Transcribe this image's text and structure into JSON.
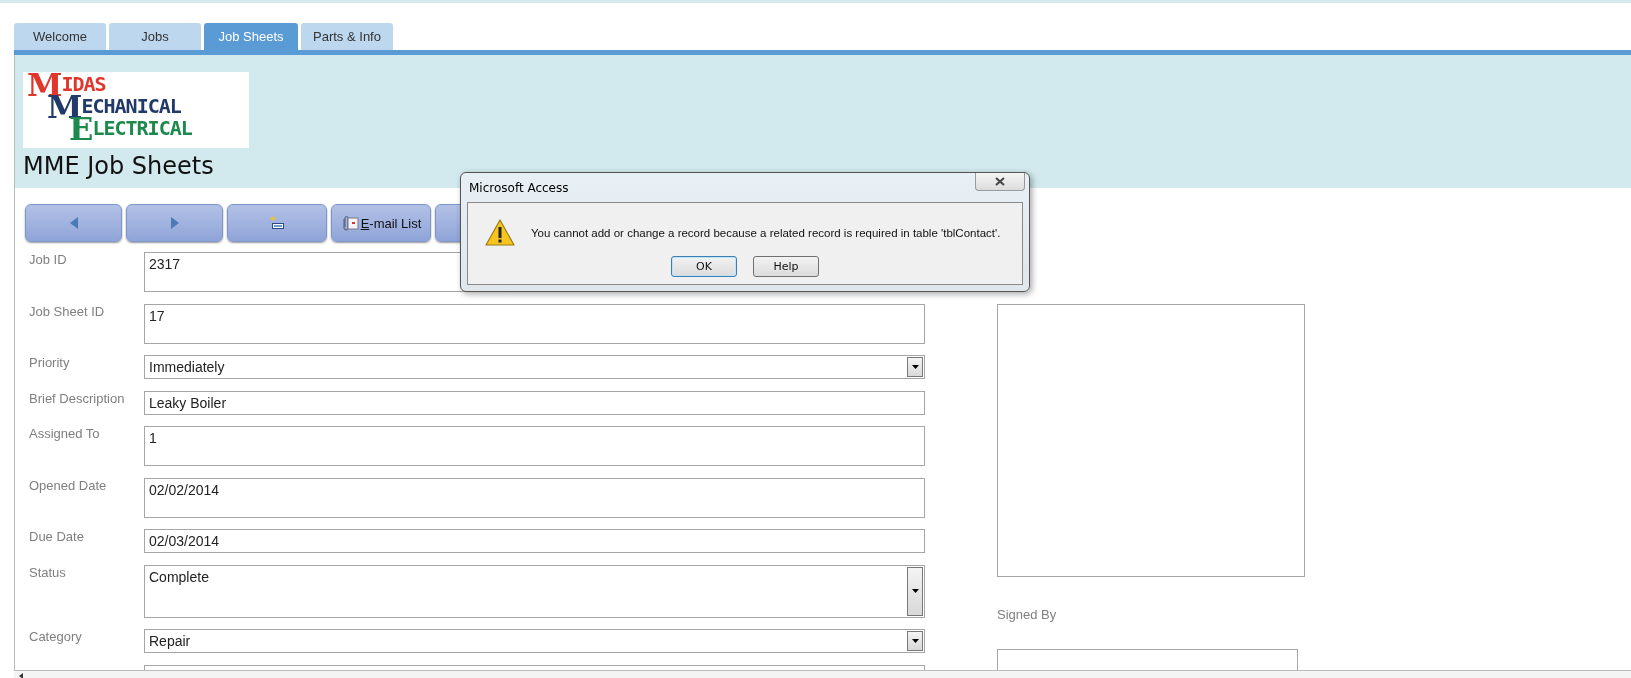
{
  "tabs": [
    {
      "label": "Welcome",
      "selected": false
    },
    {
      "label": "Jobs",
      "selected": false
    },
    {
      "label": "Job Sheets",
      "selected": true
    },
    {
      "label": "Parts & Info",
      "selected": false
    }
  ],
  "logo": {
    "lines": [
      {
        "initial": "M",
        "rest": "IDAS",
        "color": "#e0362c"
      },
      {
        "initial": "M",
        "rest": "ECHANICAL",
        "color": "#213a68"
      },
      {
        "initial": "E",
        "rest": "LECTRICAL",
        "color": "#1b8a4c"
      }
    ]
  },
  "header": {
    "title": "MME Job Sheets"
  },
  "toolbar": [
    {
      "kind": "prev"
    },
    {
      "kind": "next"
    },
    {
      "kind": "new"
    },
    {
      "kind": "email",
      "label": "E-mail List",
      "hotkey_first": true
    },
    {
      "kind": "blank"
    }
  ],
  "fields": [
    {
      "label": "Job ID",
      "value": "2317",
      "kind": "box"
    },
    {
      "label": "Job Sheet ID",
      "value": "17",
      "kind": "box"
    },
    {
      "label": "Priority",
      "value": "Immediately",
      "kind": "combo"
    },
    {
      "label": "Brief Description",
      "value": "Leaky Boiler",
      "kind": "text"
    },
    {
      "label": "Assigned To",
      "value": "1",
      "kind": "box"
    },
    {
      "label": "Opened Date",
      "value": "02/02/2014",
      "kind": "box"
    },
    {
      "label": "Due Date",
      "value": "02/03/2014",
      "kind": "text"
    },
    {
      "label": "Status",
      "value": "Complete",
      "kind": "list"
    },
    {
      "label": "Category",
      "value": "Repair",
      "kind": "combo"
    },
    {
      "kind": "stub"
    }
  ],
  "side": {
    "signed_by_label": "Signed By"
  },
  "dialog": {
    "title": "Microsoft Access",
    "message": "You cannot add or change a record because a related record is required in table 'tblContact'.",
    "buttons": [
      {
        "label": "OK",
        "default": true
      },
      {
        "label": "Help",
        "default": false
      }
    ]
  }
}
